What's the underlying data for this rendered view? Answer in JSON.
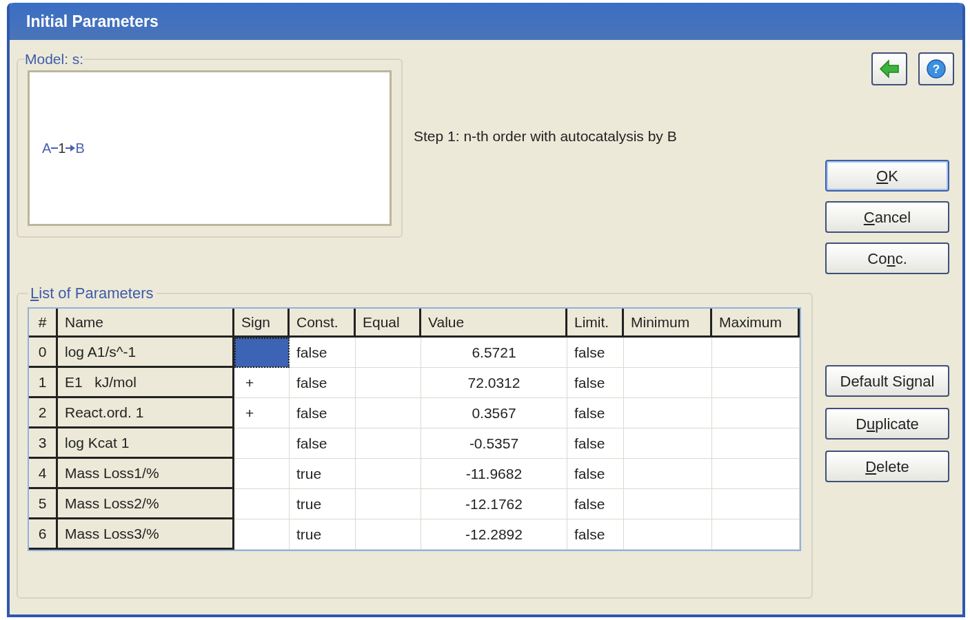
{
  "window": {
    "title": "Initial Parameters"
  },
  "model": {
    "legend": "Model: s:",
    "scheme": {
      "from": "A",
      "step": "1",
      "to": "B"
    },
    "description": "Step 1: n-th order with autocatalysis by B"
  },
  "parameters": {
    "legend": {
      "key": "L",
      "after": "ist of Parameters"
    },
    "columns": [
      "#",
      "Name",
      "Sign",
      "Const.",
      "Equal",
      "Value",
      "Limit.",
      "Minimum",
      "Maximum"
    ],
    "rows": [
      {
        "index": "0",
        "name": "log A1/s^-1",
        "selected": true,
        "const": "false",
        "value": "6.5721",
        "limit": "false"
      },
      {
        "index": "1",
        "name": "E1   kJ/mol",
        "sign": "+",
        "selected": false,
        "const": "false",
        "value": "72.0312",
        "limit": "false"
      },
      {
        "index": "2",
        "name": "React.ord. 1",
        "sign": "+",
        "selected": false,
        "const": "false",
        "value": "0.3567",
        "limit": "false"
      },
      {
        "index": "3",
        "name": "log Kcat 1",
        "selected": false,
        "const": "false",
        "value": "-0.5357",
        "limit": "false"
      },
      {
        "index": "4",
        "name": "Mass Loss1/%",
        "selected": false,
        "const": "true",
        "value": "-11.9682",
        "limit": "false"
      },
      {
        "index": "5",
        "name": "Mass Loss2/%",
        "selected": false,
        "const": "true",
        "value": "-12.1762",
        "limit": "false"
      },
      {
        "index": "6",
        "name": "Mass Loss3/%",
        "selected": false,
        "const": "true",
        "value": "-12.2892",
        "limit": "false"
      }
    ]
  },
  "top_buttons": [
    {
      "kind": "back"
    },
    {
      "kind": "help",
      "symbol": "?"
    }
  ],
  "buttons": [
    {
      "key": "O",
      "after": "K",
      "default": true
    },
    {
      "key": "C",
      "after": "ancel",
      "default": false
    },
    {
      "before": "Co",
      "key": "n",
      "after": "c.",
      "default": false
    }
  ],
  "lower_buttons": [
    {
      "before": "Default Signal",
      "default": false
    },
    {
      "before": "D",
      "key": "u",
      "after": "plicate",
      "default": false
    },
    {
      "key": "D",
      "after": "elete",
      "default": false
    }
  ]
}
